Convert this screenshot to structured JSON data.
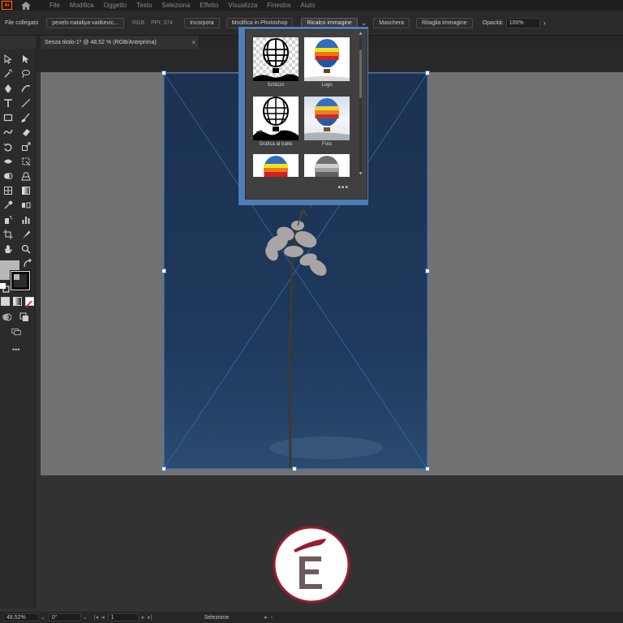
{
  "app": {
    "logo_text": "Ai"
  },
  "menu": [
    "File",
    "Modifica",
    "Oggetto",
    "Testo",
    "Seleziona",
    "Effetto",
    "Visualizza",
    "Finestra",
    "Aiuto"
  ],
  "controlbar": {
    "linked_file_label": "File collegato",
    "file_name": "pexels-nataliya-vaitkevic...",
    "color_mode": "RGB",
    "ppi": "PPI: 374",
    "embed_label": "Incorpora",
    "edit_photoshop_label": "Modifica in Photoshop",
    "image_trace_label": "Ricalco immagine",
    "mask_label": "Maschera",
    "crop_label": "Ritaglia immagine",
    "opacity_label": "Opacità:",
    "opacity_value": "100%"
  },
  "document": {
    "tab_title": "Senza titolo-1* @ 48,52 % (RGB/Anteprima)",
    "close_glyph": "×"
  },
  "trace_presets": [
    {
      "label": "Schizzo",
      "style": "checker"
    },
    {
      "label": "Logo",
      "style": "white"
    },
    {
      "label": "Grafica al tratto",
      "style": "white"
    },
    {
      "label": "Foto",
      "style": "sky"
    },
    {
      "label": "",
      "style": "white"
    },
    {
      "label": "",
      "style": "white"
    }
  ],
  "popup": {
    "more_glyph": "•••"
  },
  "statusbar": {
    "zoom": "48,52%",
    "rotation": "0°",
    "artboard_index": "1",
    "tool_status": "Selezione"
  },
  "colors": {
    "accent_blue": "#4e7eb6",
    "artboard_gray": "#717171",
    "logo_red": "#9b1b30"
  },
  "icons": [
    "home-icon",
    "selection-tool-icon",
    "direct-selection-tool-icon",
    "magic-wand-icon",
    "lasso-icon",
    "pen-icon",
    "curvature-icon",
    "type-icon",
    "line-icon",
    "rectangle-icon",
    "paintbrush-icon",
    "shaper-icon",
    "eraser-icon",
    "rotate-icon",
    "scale-icon",
    "width-icon",
    "free-transform-icon",
    "shape-builder-icon",
    "perspective-grid-icon",
    "mesh-icon",
    "gradient-icon",
    "eyedropper-icon",
    "blend-icon",
    "symbol-sprayer-icon",
    "column-graph-icon",
    "artboard-icon",
    "slice-icon",
    "hand-icon",
    "zoom-icon"
  ]
}
